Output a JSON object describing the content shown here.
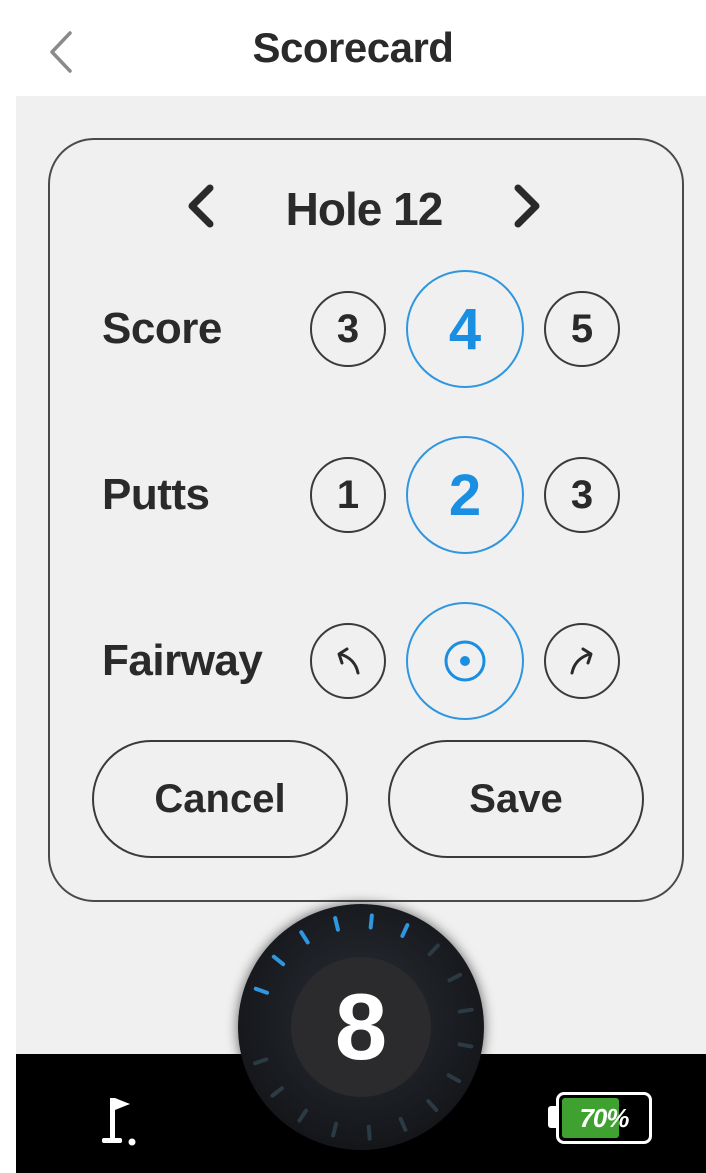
{
  "header": {
    "title": "Scorecard",
    "back_icon": "chevron-left-icon"
  },
  "hole": {
    "title": "Hole 12",
    "prev_icon": "chevron-left-icon",
    "next_icon": "chevron-right-icon"
  },
  "score": {
    "label": "Score",
    "options": [
      "3",
      "4",
      "5"
    ],
    "selected": "4"
  },
  "putts": {
    "label": "Putts",
    "options": [
      "1",
      "2",
      "3"
    ],
    "selected": "2"
  },
  "fairway": {
    "label": "Fairway",
    "options": [
      "miss-left-icon",
      "fairway-hit-icon",
      "miss-right-icon"
    ],
    "selected": "fairway-hit-icon"
  },
  "actions": {
    "cancel_label": "Cancel",
    "save_label": "Save"
  },
  "dial": {
    "value": "8",
    "fraction_highlighted": 0.35
  },
  "status": {
    "battery_text": "70%",
    "battery_level": 0.7,
    "flag_icon": "golf-flag-icon"
  },
  "colors": {
    "accent": "#1a8ee0",
    "background": "#f0f0f0",
    "bottom_bar": "#000000",
    "battery": "#3fa12f"
  }
}
